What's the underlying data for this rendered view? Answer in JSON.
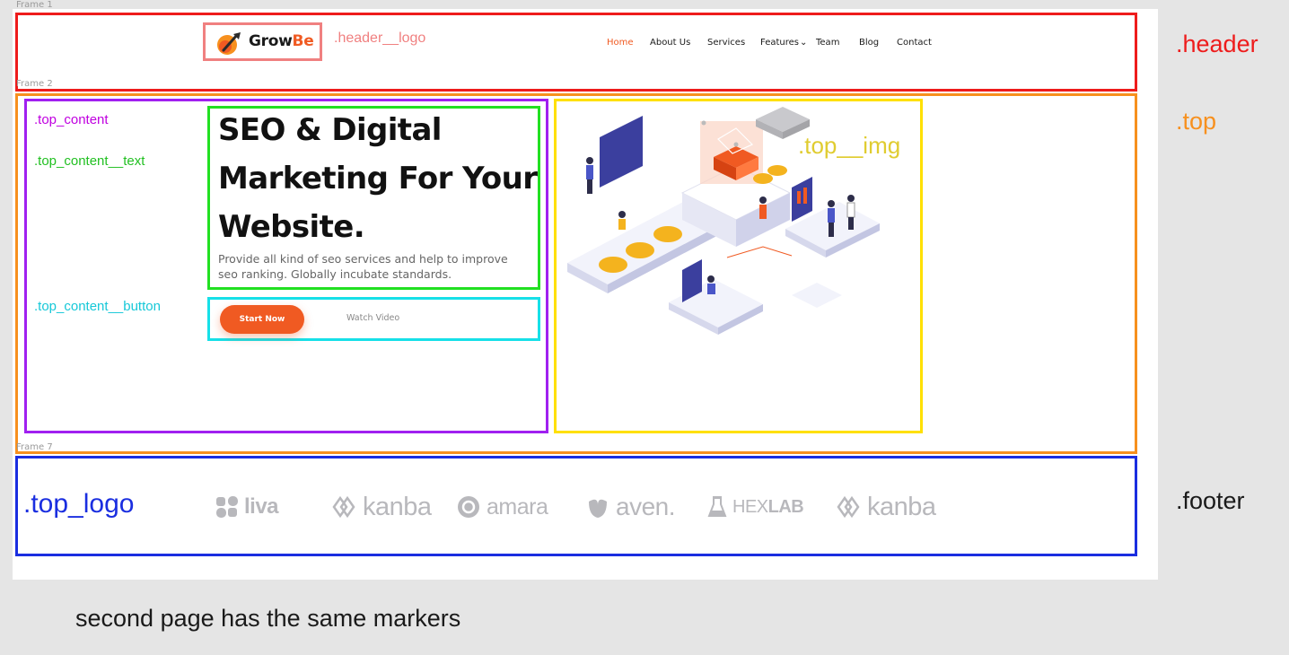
{
  "frames": {
    "frame1": "Frame 1",
    "frame2": "Frame 2",
    "frame7": "Frame 7"
  },
  "annotations": {
    "header_logo": ".header__logo",
    "header": ".header",
    "top": ".top",
    "top_content": ".top_content",
    "top_content_text": ".top_content__text",
    "top_content_button": ".top_content__button",
    "top_img": ".top__img",
    "top_logo": ".top_logo",
    "footer": ".footer"
  },
  "header": {
    "logo": {
      "name_part1": "Grow",
      "name_part2": "Be",
      "icon": "rocket-icon"
    },
    "nav": [
      "Home",
      "About Us",
      "Services",
      "Features",
      "Team",
      "Blog",
      "Contact"
    ],
    "features_caret": "⌄"
  },
  "hero": {
    "title_line1": "SEO & Digital",
    "title_line2": "Marketing For Your",
    "title_line3": "Website.",
    "description": "Provide all kind of seo services and help to improve seo ranking. Globally incubate standards.",
    "primary_button": "Start Now",
    "secondary_button": "Watch Video"
  },
  "brands": [
    "liva",
    "kanba",
    "amara",
    "aven.",
    "HEXLAB",
    "kanba"
  ],
  "hexlab": {
    "part1": "HEX",
    "part2": "LAB"
  },
  "colors": {
    "accent": "#f05a22",
    "header_box": "#ee1c1c",
    "top_box": "#f7901e",
    "top_content_box": "#a020f0",
    "text_box": "#22e022",
    "button_box": "#16e0e8",
    "img_box": "#ffe000",
    "footer_box": "#1a2ee0",
    "logo_box": "#f08080"
  },
  "note": "second page has the same markers"
}
